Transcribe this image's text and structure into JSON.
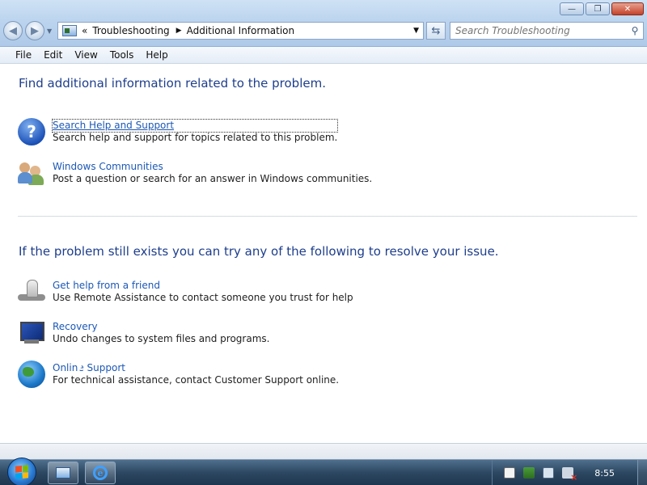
{
  "window": {
    "minimize_glyph": "—",
    "maximize_glyph": "❐",
    "close_glyph": "✕"
  },
  "address_bar": {
    "overflow_glyph": "«",
    "segments": [
      "Troubleshooting",
      "Additional Information"
    ],
    "separator": "▶",
    "dropdown_glyph": "▼"
  },
  "search": {
    "placeholder": "Search Troubleshooting"
  },
  "menu": {
    "items": [
      "File",
      "Edit",
      "View",
      "Tools",
      "Help"
    ]
  },
  "content": {
    "section1_heading": "Find additional information related to the problem.",
    "section1_items": [
      {
        "link": "Search Help and Support",
        "desc": "Search help and support for topics related to this problem.",
        "icon": "help-icon"
      },
      {
        "link": "Windows Communities",
        "desc": "Post a question or search for an answer in Windows communities.",
        "icon": "people-icon"
      }
    ],
    "section2_heading": "If the problem still exists you can try any of the following to resolve your issue.",
    "section2_items": [
      {
        "link": "Get help from a friend",
        "desc": "Use Remote Assistance to contact someone you trust for help",
        "icon": "remote-assistance-icon"
      },
      {
        "link": "Recovery",
        "desc": "Undo changes to system files and programs.",
        "icon": "recovery-icon"
      },
      {
        "link": "Online Support",
        "desc": "For technical assistance, contact Customer Support online.",
        "icon": "globe-icon"
      }
    ]
  },
  "taskbar": {
    "clock": "8:55",
    "apps": [
      "control-panel-icon",
      "internet-explorer-icon"
    ],
    "tray_icons": [
      "document-icon",
      "action-center-flag-icon",
      "network-icon",
      "volume-muted-icon"
    ]
  }
}
